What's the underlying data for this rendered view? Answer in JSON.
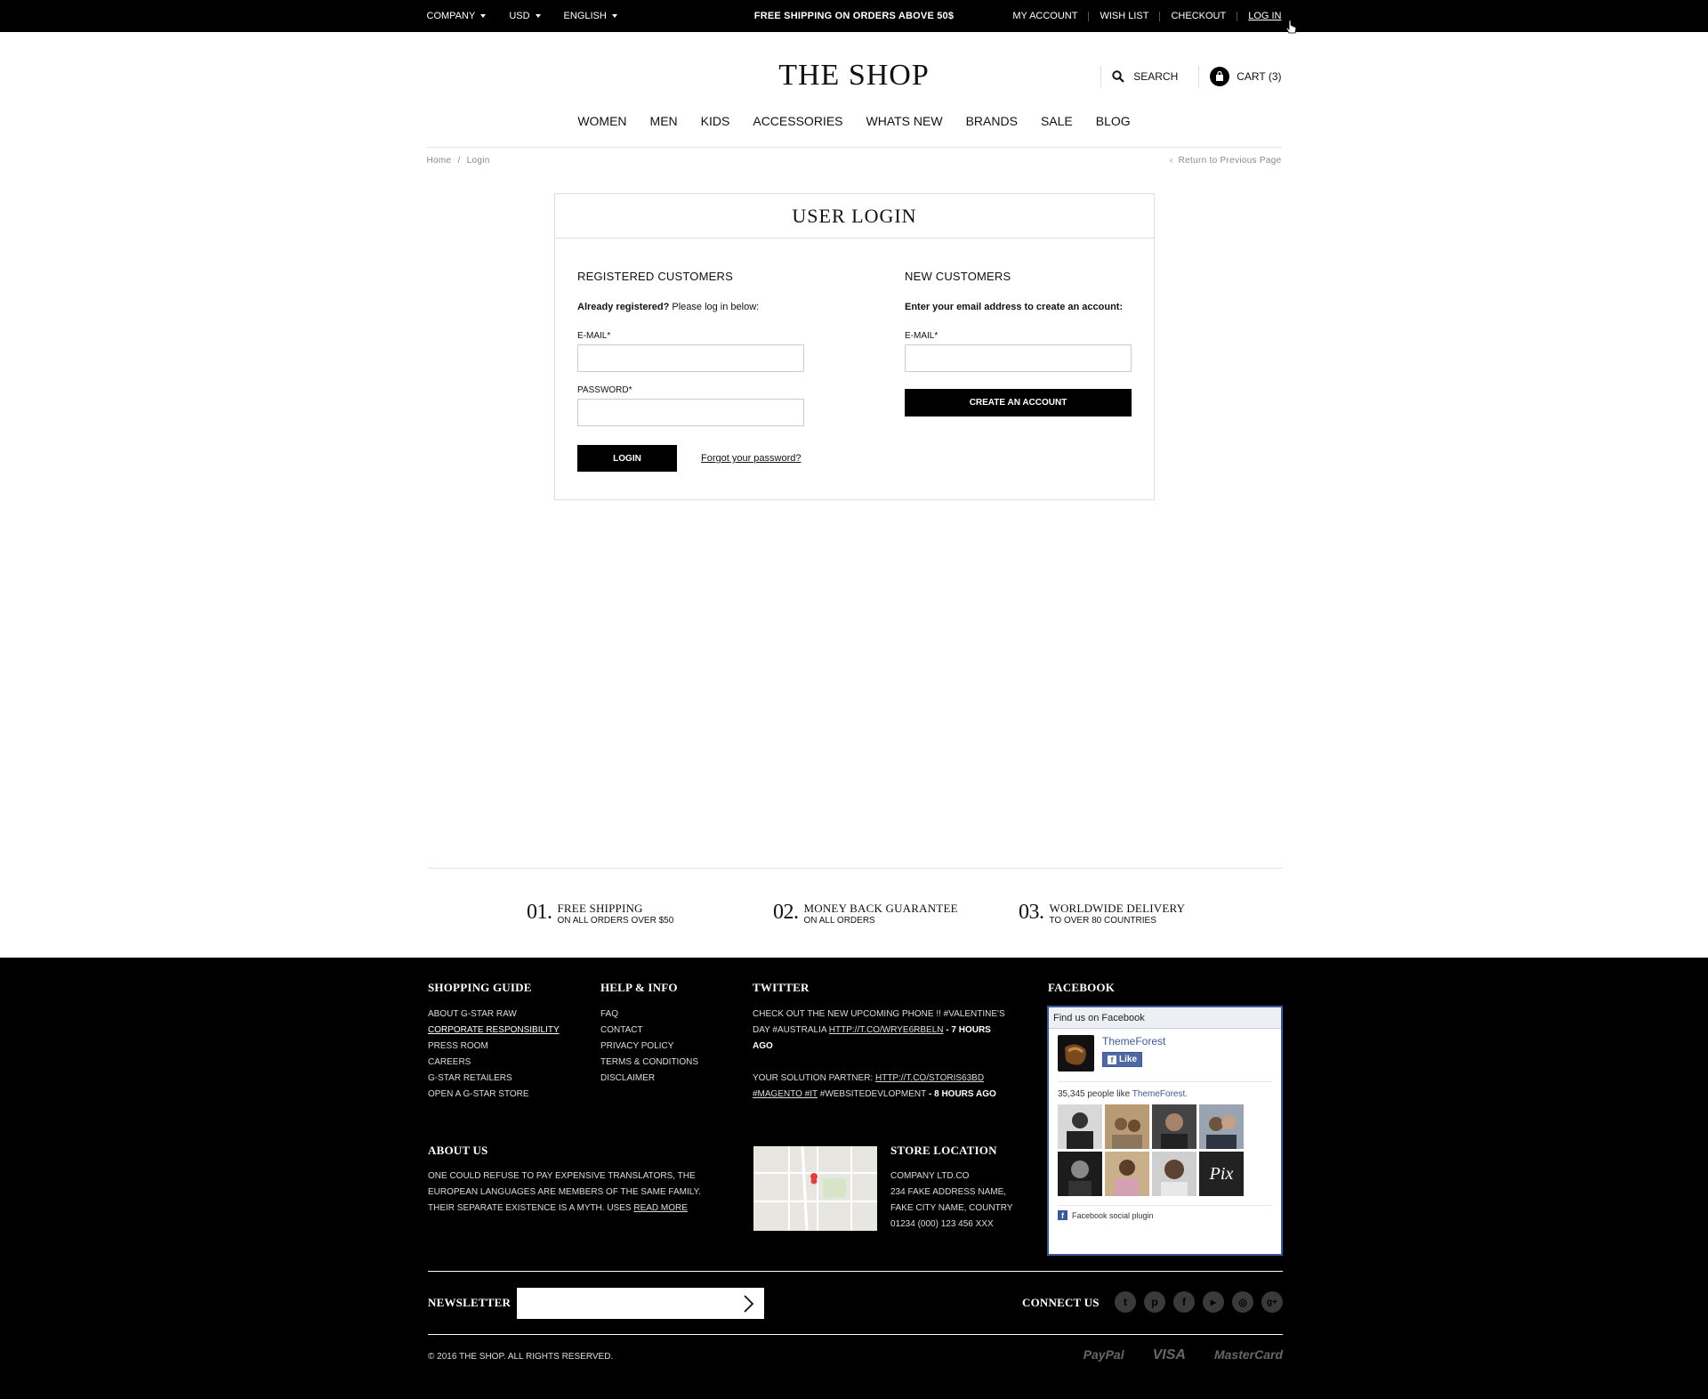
{
  "topbar": {
    "company": "COMPANY",
    "currency": "USD",
    "language": "ENGLISH",
    "promo": "FREE SHIPPING ON ORDERS ABOVE 50$",
    "links": [
      "MY ACCOUNT",
      "WISH LIST",
      "CHECKOUT",
      "LOG IN"
    ]
  },
  "header": {
    "logo": "THE SHOP",
    "search_label": "SEARCH",
    "cart_label": "CART (3)",
    "nav": [
      "WOMEN",
      "MEN",
      "KIDS",
      "ACCESSORIES",
      "WHATS NEW",
      "BRANDS",
      "SALE",
      "BLOG"
    ]
  },
  "breadcrumb": {
    "home": "Home",
    "separator": "/",
    "current": "Login",
    "return_link": "Return to Previous Page"
  },
  "login": {
    "title": "USER LOGIN",
    "registered": {
      "heading": "REGISTERED CUSTOMERS",
      "intro_bold": "Already registered?",
      "intro_rest": " Please log in below:",
      "email_label": "E-MAIL*",
      "email_value": "",
      "password_label": "PASSWORD*",
      "password_value": "",
      "login_button": "LOGIN",
      "forgot_link": "Forgot your password?"
    },
    "new": {
      "heading": "NEW CUSTOMERS",
      "intro": "Enter your email address to create an account:",
      "email_label": "E-MAIL*",
      "email_value": "",
      "create_button": "CREATE AN ACCOUNT"
    }
  },
  "features": [
    {
      "num": "01.",
      "title": "FREE SHIPPING",
      "sub": "ON ALL ORDERS OVER $50"
    },
    {
      "num": "02.",
      "title": "MONEY BACK GUARANTEE",
      "sub": "ON ALL ORDERS"
    },
    {
      "num": "03.",
      "title": "WORLDWIDE DELIVERY",
      "sub": "TO OVER 80 COUNTRIES"
    }
  ],
  "footer": {
    "shopping_guide": {
      "title": "SHOPPING GUIDE",
      "items": [
        "ABOUT G-STAR RAW",
        "CORPORATE RESPONSIBILITY",
        "PRESS ROOM",
        "CAREERS",
        "G-STAR RETAILERS",
        "OPEN A G-STAR STORE"
      ]
    },
    "help_info": {
      "title": "HELP & INFO",
      "items": [
        "FAQ",
        "CONTACT",
        "PRIVACY POLICY",
        "TERMS & CONDITIONS",
        "DISCLAIMER"
      ]
    },
    "twitter": {
      "title": "TWITTER",
      "tweet1_text": "CHECK OUT THE NEW UPCOMING PHONE !! #VALENTINE'S DAY #AUSTRALIA ",
      "tweet1_link": "HTTP://T.CO/WRYE6RBELN",
      "tweet1_time": " - 7 HOURS AGO",
      "tweet2_text": "YOUR SOLUTION PARTNER: ",
      "tweet2_link": "HTTP://T.CO/STORIS63BD",
      "tweet2_tag": "#MAGENTO #IT",
      "tweet2_rest": " #WEBSITEDEVLOPMENT",
      "tweet2_time": " - 8 HOURS AGO"
    },
    "facebook": {
      "title": "FACEBOOK",
      "header": "Find us on Facebook",
      "page_name": "ThemeForest",
      "like_label": "Like",
      "count_text": "35,345 people like ",
      "count_page": "ThemeForest.",
      "plugin_label": "Facebook social plugin",
      "last_face_text": "Pix"
    },
    "about": {
      "title": "ABOUT US",
      "text": "ONE COULD REFUSE TO PAY EXPENSIVE TRANSLATORS, THE EUROPEAN LANGUAGES ARE MEMBERS OF THE SAME FAMILY. THEIR SEPARATE EXISTENCE IS A MYTH. USES ",
      "read_more": "READ MORE"
    },
    "store": {
      "title": "STORE LOCATION",
      "lines": [
        "COMPANY LTD.CO",
        "234 FAKE ADDRESS NAME,",
        "FAKE CITY NAME, COUNTRY",
        "01234 (000) 123 456 XXX"
      ]
    },
    "newsletter": {
      "title": "NEWSLETTER",
      "placeholder": ""
    },
    "connect": {
      "title": "CONNECT US",
      "icons": [
        "twitter-icon",
        "pinterest-icon",
        "facebook-icon",
        "youtube-icon",
        "instagram-icon",
        "google-plus-icon"
      ]
    },
    "copyright": "© 2016 THE SHOP. ALL RIGHTS RESERVED.",
    "payments": [
      "PayPal",
      "VISA",
      "MasterCard"
    ]
  }
}
